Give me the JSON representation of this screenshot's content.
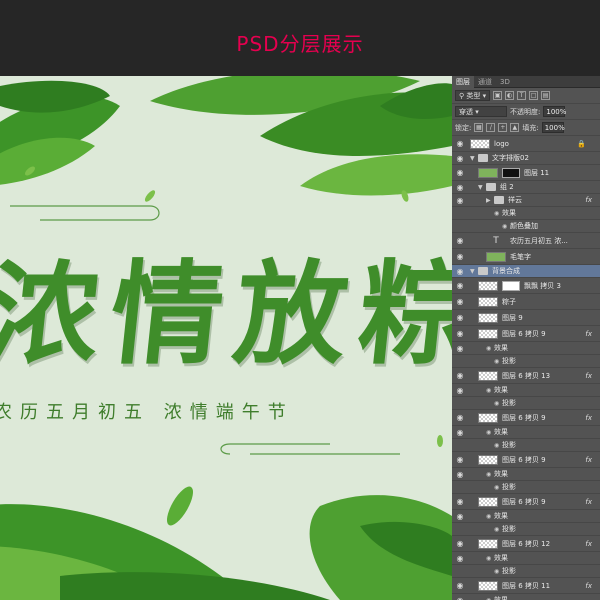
{
  "header": {
    "title": "PSD分层展示"
  },
  "artwork": {
    "main_title": "浓情放粽",
    "sub_title": "农历五月初五  浓情端午节",
    "colors": {
      "background": "#dde9d8",
      "title": "#3f8d2a",
      "leaf_dark": "#2f7d20",
      "leaf_light": "#7cc04a"
    }
  },
  "panel": {
    "tabs": [
      "图层",
      "通道",
      "3D"
    ],
    "filter_label": "类型",
    "blend_mode": "穿透",
    "opacity_label": "不透明度:",
    "opacity_value": "100%",
    "lock_label": "锁定:",
    "fill_label": "填充:",
    "fill_value": "100%",
    "layers": [
      {
        "name": "logo",
        "kind": "layer",
        "level": 0,
        "lock": true
      },
      {
        "name": "文字排版02",
        "kind": "group",
        "level": 0,
        "open": true
      },
      {
        "name": "图层 11",
        "kind": "masked",
        "level": 1
      },
      {
        "name": "组 2",
        "kind": "group",
        "level": 1,
        "open": true
      },
      {
        "name": "祥云",
        "kind": "group",
        "level": 2,
        "open": false,
        "fx": "fx"
      },
      {
        "name": "效果",
        "kind": "effect",
        "level": 3
      },
      {
        "name": "颜色叠加",
        "kind": "effect",
        "level": 4
      },
      {
        "name": "农历五月初五 浓...",
        "kind": "text",
        "level": 2
      },
      {
        "name": "毛笔字",
        "kind": "green",
        "level": 2
      },
      {
        "name": "背景合成",
        "kind": "group",
        "level": 0,
        "open": true,
        "selected": true
      },
      {
        "name": "飘飘 拷贝 3",
        "kind": "masked2",
        "level": 1
      },
      {
        "name": "粽子",
        "kind": "layer",
        "level": 1
      },
      {
        "name": "图层 9",
        "kind": "layer",
        "level": 1
      },
      {
        "name": "图层 6 拷贝 9",
        "kind": "layer",
        "level": 1,
        "fx": "fx"
      },
      {
        "name": "效果",
        "kind": "effect",
        "level": 2
      },
      {
        "name": "投影",
        "kind": "effect",
        "level": 3
      },
      {
        "name": "图层 6 拷贝 13",
        "kind": "layer",
        "level": 1,
        "fx": "fx"
      },
      {
        "name": "效果",
        "kind": "effect",
        "level": 2
      },
      {
        "name": "投影",
        "kind": "effect",
        "level": 3
      },
      {
        "name": "图层 6 拷贝 9",
        "kind": "layer",
        "level": 1,
        "fx": "fx"
      },
      {
        "name": "效果",
        "kind": "effect",
        "level": 2
      },
      {
        "name": "投影",
        "kind": "effect",
        "level": 3
      },
      {
        "name": "图层 6 拷贝 9",
        "kind": "layer",
        "level": 1,
        "fx": "fx"
      },
      {
        "name": "效果",
        "kind": "effect",
        "level": 2
      },
      {
        "name": "投影",
        "kind": "effect",
        "level": 3
      },
      {
        "name": "图层 6 拷贝 9",
        "kind": "layer",
        "level": 1,
        "fx": "fx"
      },
      {
        "name": "效果",
        "kind": "effect",
        "level": 2
      },
      {
        "name": "投影",
        "kind": "effect",
        "level": 3
      },
      {
        "name": "图层 6 拷贝 12",
        "kind": "layer",
        "level": 1,
        "fx": "fx"
      },
      {
        "name": "效果",
        "kind": "effect",
        "level": 2
      },
      {
        "name": "投影",
        "kind": "effect",
        "level": 3
      },
      {
        "name": "图层 6 拷贝 11",
        "kind": "layer",
        "level": 1,
        "fx": "fx"
      },
      {
        "name": "效果",
        "kind": "effect",
        "level": 2
      },
      {
        "name": "投影",
        "kind": "effect",
        "level": 3
      }
    ]
  }
}
